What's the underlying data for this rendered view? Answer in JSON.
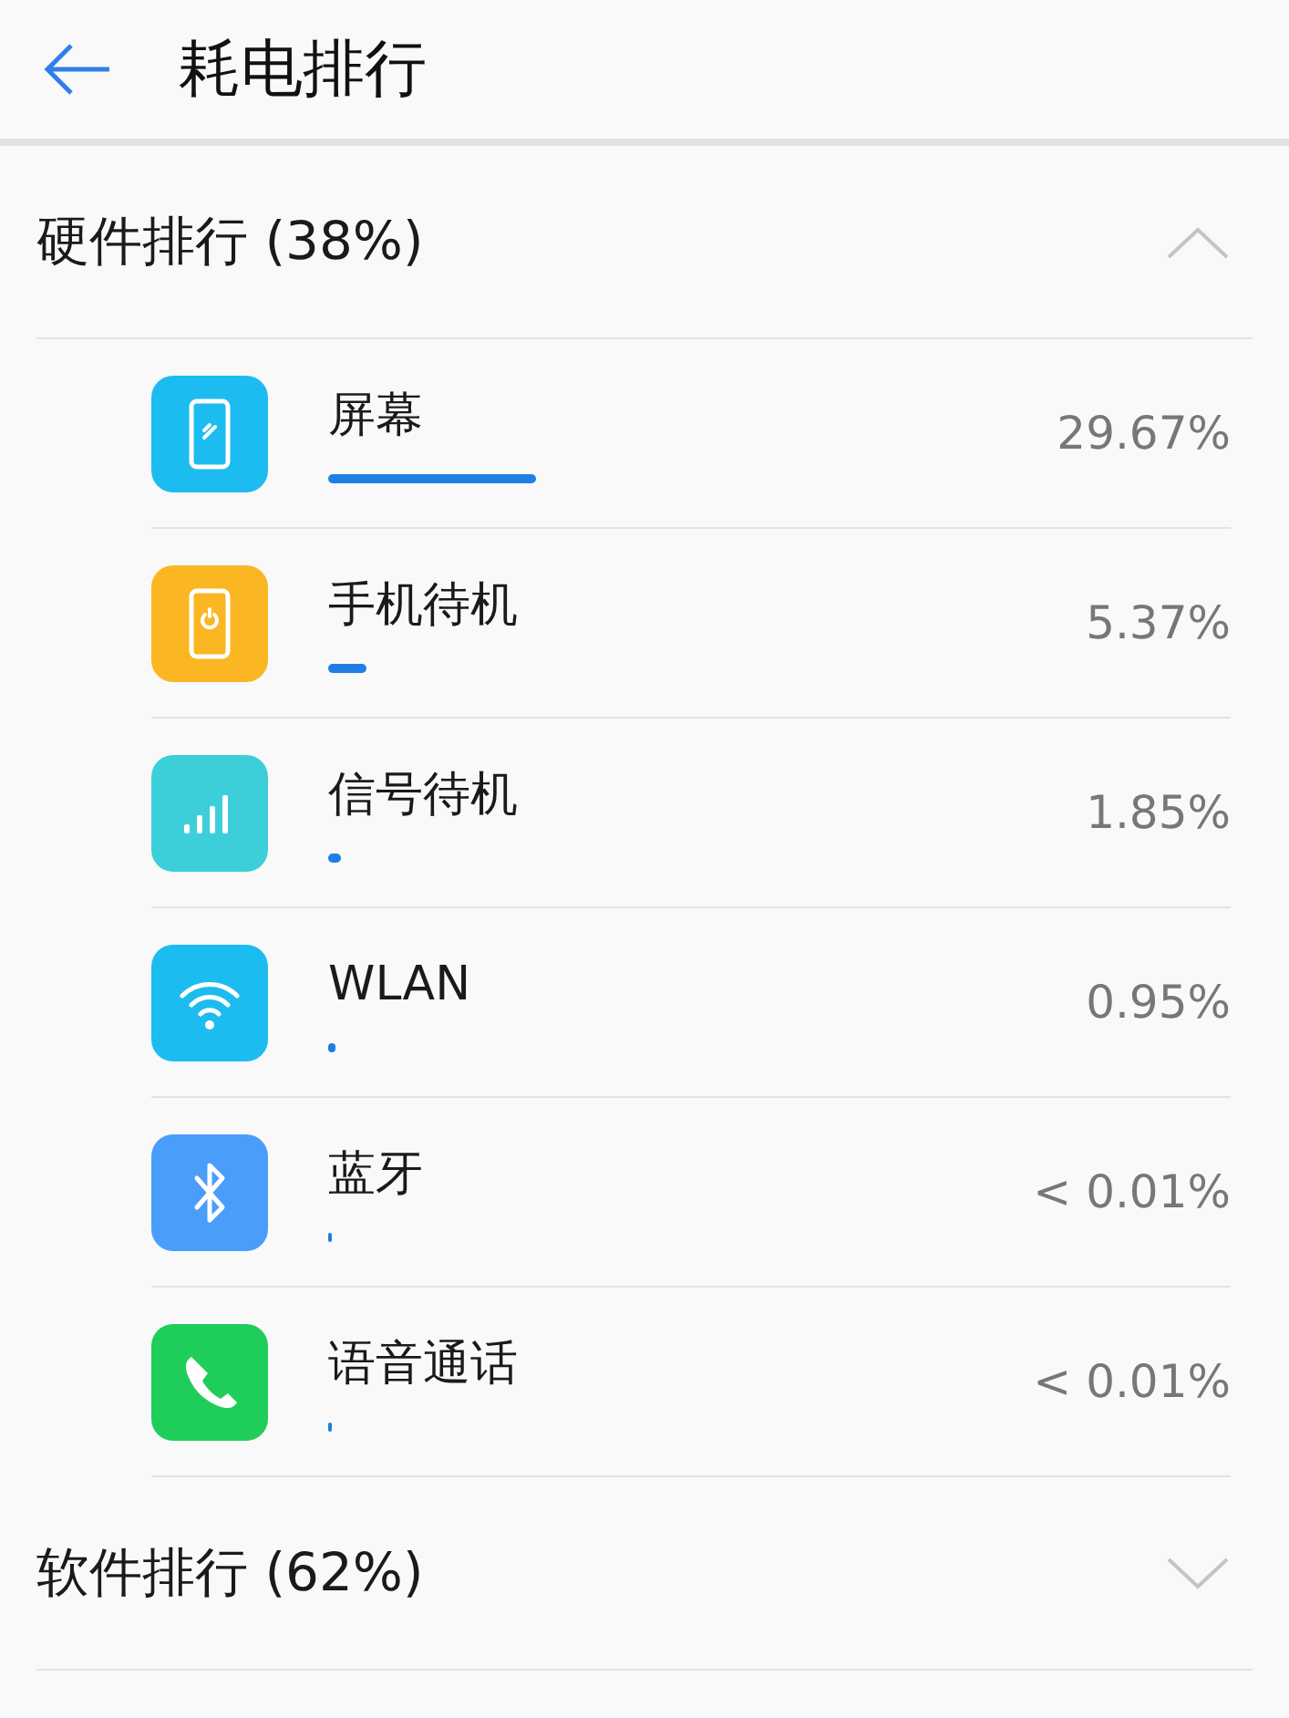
{
  "title": "耗电排行",
  "sections": [
    {
      "label": "硬件排行 (38%)",
      "expanded": true,
      "items": [
        {
          "name": "屏幕",
          "kind": "screen",
          "color": "#1cbcf0",
          "reading": "29.67%"
        },
        {
          "name": "手机待机",
          "kind": "standby",
          "color": "#fbb623",
          "reading": "5.37%"
        },
        {
          "name": "信号待机",
          "kind": "signal",
          "color": "#3ccfd9",
          "reading": "1.85%"
        },
        {
          "name": "WLAN",
          "kind": "wifi",
          "color": "#1cbcf0",
          "reading": "0.95%"
        },
        {
          "name": "蓝牙",
          "kind": "bluetooth",
          "color": "#4a9efa",
          "reading": "< 0.01%"
        },
        {
          "name": "语音通话",
          "kind": "call",
          "color": "#1fcd5a",
          "reading": "< 0.01%"
        }
      ]
    },
    {
      "label": "软件排行 (62%)",
      "expanded": false
    }
  ]
}
